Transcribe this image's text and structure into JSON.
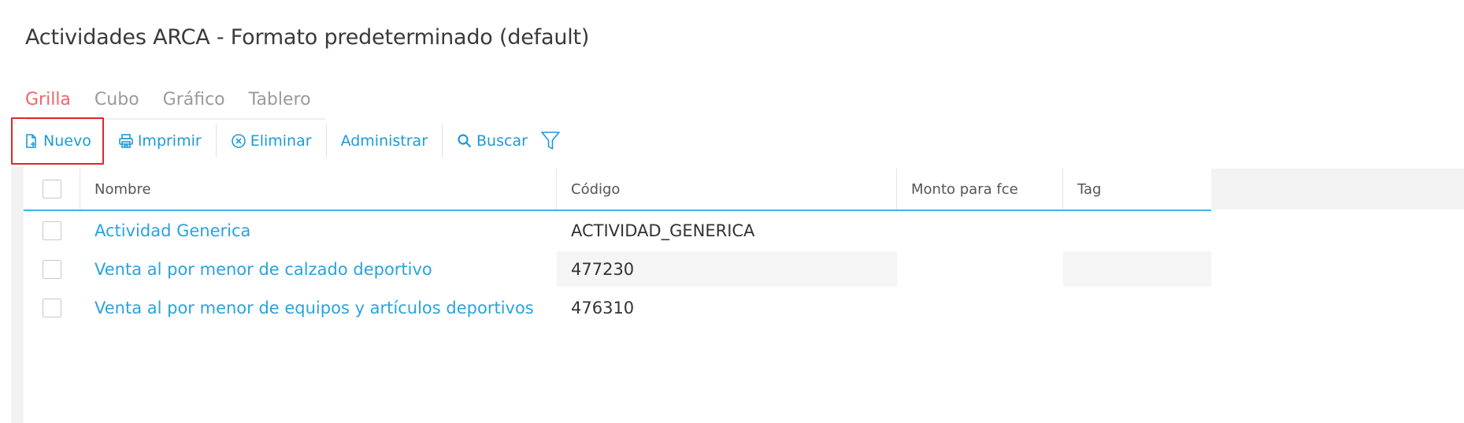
{
  "page": {
    "title": "Actividades ARCA - Formato predeterminado (default)"
  },
  "tabs": [
    {
      "label": "Grilla",
      "active": true
    },
    {
      "label": "Cubo",
      "active": false
    },
    {
      "label": "Gráfico",
      "active": false
    },
    {
      "label": "Tablero",
      "active": false
    }
  ],
  "toolbar": {
    "new_label": "Nuevo",
    "print_label": "Imprimir",
    "delete_label": "Eliminar",
    "manage_label": "Administrar",
    "search_label": "Buscar"
  },
  "grid": {
    "columns": [
      "Nombre",
      "Código",
      "Monto para fce",
      "Tag"
    ],
    "rows": [
      {
        "nombre": "Actividad Generica",
        "codigo": "ACTIVIDAD_GENERICA",
        "monto": "",
        "tag": ""
      },
      {
        "nombre": "Venta al por menor de calzado deportivo",
        "codigo": "477230",
        "monto": "",
        "tag": ""
      },
      {
        "nombre": "Venta al por menor de equipos y artículos deportivos",
        "codigo": "476310",
        "monto": "",
        "tag": ""
      }
    ]
  },
  "colors": {
    "accent": "#1e9ad6",
    "active_tab": "#f0656b",
    "highlight_border": "#e0262d"
  },
  "icons": {
    "new": "file-plus-icon",
    "print": "printer-icon",
    "delete": "circle-x-icon",
    "search": "search-icon",
    "filter": "filter-icon"
  }
}
